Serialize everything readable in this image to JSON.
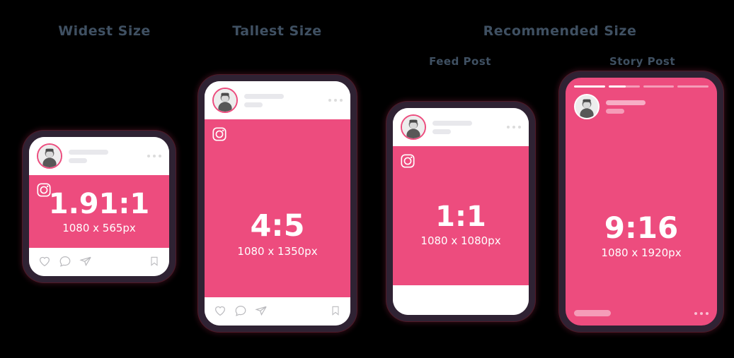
{
  "headings": {
    "widest": "Widest Size",
    "tallest": "Tallest Size",
    "recommended": "Recommended Size",
    "feed_post": "Feed Post",
    "story_post": "Story Post"
  },
  "colors": {
    "brand_pink": "#ed4c7e",
    "heading_text": "#3f5062",
    "phone_frame": "#2f2233",
    "screen_white": "#ffffff",
    "placeholder_gray": "#e8e8ec",
    "icon_gray": "#b9b9bd",
    "background": "#000000"
  },
  "phones": [
    {
      "id": "widest",
      "kind": "feed-post",
      "ratio": "1.91:1",
      "dimensions": "1080 x 565px",
      "has_action_bar": true,
      "instagram_badge": "instagram-icon"
    },
    {
      "id": "tallest",
      "kind": "feed-post",
      "ratio": "4:5",
      "dimensions": "1080 x 1350px",
      "has_action_bar": true,
      "instagram_badge": "instagram-icon"
    },
    {
      "id": "feed",
      "kind": "feed-post",
      "ratio": "1:1",
      "dimensions": "1080 x 1080px",
      "has_action_bar": false,
      "instagram_badge": "instagram-icon"
    },
    {
      "id": "story",
      "kind": "story-post",
      "ratio": "9:16",
      "dimensions": "1080 x 1920px",
      "has_action_bar": false,
      "story_progress_percent": [
        100,
        55,
        0,
        0
      ]
    }
  ],
  "icons": {
    "like": "heart-icon",
    "comment": "comment-icon",
    "share": "paper-plane-icon",
    "save": "bookmark-icon",
    "more": "more-options-icon",
    "instagram": "instagram-icon",
    "avatar": "avatar-icon"
  }
}
